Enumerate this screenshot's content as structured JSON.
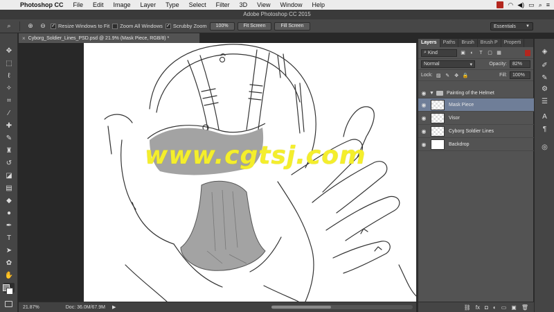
{
  "menubar": {
    "app": "Photoshop CC",
    "items": [
      "File",
      "Edit",
      "Image",
      "Layer",
      "Type",
      "Select",
      "Filter",
      "3D",
      "View",
      "Window",
      "Help"
    ]
  },
  "window_title": "Adobe Photoshop CC 2015",
  "options": {
    "resize_windows": "Resize Windows to Fit",
    "zoom_all": "Zoom All Windows",
    "scrubby": "Scrubby Zoom",
    "zoom_100": "100%",
    "fit_screen": "Fit Screen",
    "fill_screen": "Fill Screen",
    "workspace": "Essentials"
  },
  "document_tab": "Cyborg_Soldier_Lines_PSD.psd @ 21.9% (Mask Piece, RGB/8) *",
  "status": {
    "zoom": "21.87%",
    "doc": "Doc: 36.0M/67.9M"
  },
  "watermark": "www.cgtsj.com",
  "panel": {
    "tabs": [
      "Layers",
      "Paths",
      "Brush",
      "Brush P",
      "Properti"
    ],
    "filter_kind": "Kind",
    "blend_mode": "Normal",
    "opacity_label": "Opacity:",
    "opacity_value": "82%",
    "lock_label": "Lock:",
    "fill_label": "Fill:",
    "fill_value": "100%",
    "layers": [
      {
        "name": "Painting of the Helmet"
      },
      {
        "name": "Mask Piece"
      },
      {
        "name": "Visor"
      },
      {
        "name": "Cyborg Soldier Lines"
      },
      {
        "name": "Backdrop"
      }
    ]
  },
  "colors": {
    "selected_layer": "#6f7e98",
    "accent_red": "#b3261e",
    "watermark": "#f4ee2c",
    "mask_gray": "#a3a3a3"
  },
  "icons": {
    "tools": [
      "move",
      "marquee",
      "lasso",
      "magic-wand",
      "crop",
      "eyedropper",
      "healing",
      "brush",
      "clone-stamp",
      "history-brush",
      "eraser",
      "gradient",
      "blur",
      "dodge",
      "pen",
      "type",
      "path-select",
      "shape",
      "hand",
      "zoom"
    ]
  }
}
